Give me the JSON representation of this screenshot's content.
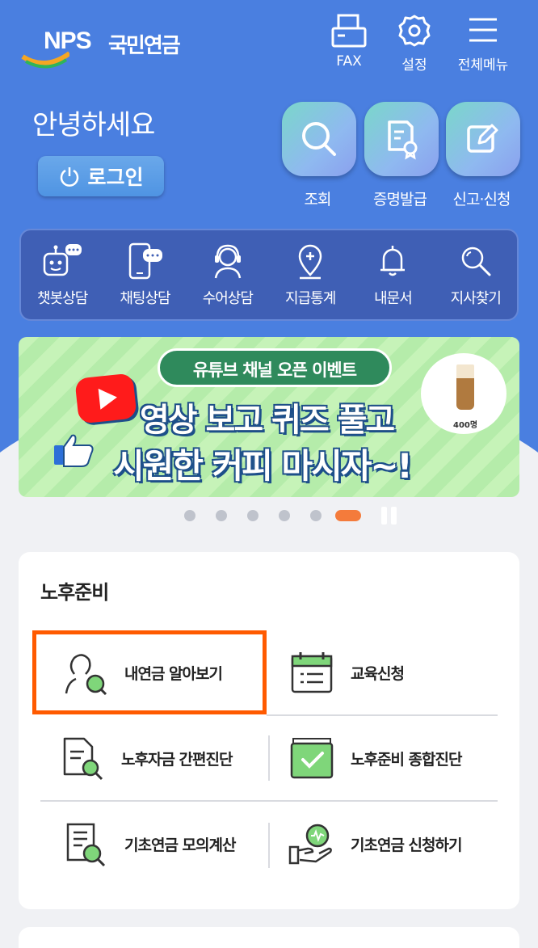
{
  "header": {
    "logo_text": "NPS",
    "logo_name": "국민연금",
    "buttons": [
      {
        "label": "FAX",
        "icon": "fax-icon"
      },
      {
        "label": "설정",
        "icon": "gear-icon"
      },
      {
        "label": "전체메뉴",
        "icon": "menu-icon"
      }
    ]
  },
  "greeting": {
    "text": "안녕하세요",
    "login_label": "로그인"
  },
  "quick_actions": [
    {
      "label": "조회",
      "icon": "search-icon"
    },
    {
      "label": "증명발급",
      "icon": "certificate-icon"
    },
    {
      "label": "신고·신청",
      "icon": "edit-icon"
    }
  ],
  "services": [
    {
      "label": "챗봇상담",
      "icon": "chatbot-icon"
    },
    {
      "label": "채팅상담",
      "icon": "chat-phone-icon"
    },
    {
      "label": "수어상담",
      "icon": "sign-language-icon"
    },
    {
      "label": "지급통계",
      "icon": "location-icon"
    },
    {
      "label": "내문서",
      "icon": "bell-icon"
    },
    {
      "label": "지사찾기",
      "icon": "search-icon"
    }
  ],
  "banner": {
    "pill": "유튜브 채널 오픈 이벤트",
    "line1": "영상 보고 퀴즈 풀고",
    "line2": "시원한 커피 마시자~!",
    "coffee_count": "400명",
    "dot_count": 6,
    "active_dot": 6
  },
  "retirement": {
    "title": "노후준비",
    "items": [
      {
        "label": "내연금 알아보기",
        "icon": "person-search-icon"
      },
      {
        "label": "교육신청",
        "icon": "calendar-icon"
      },
      {
        "label": "노후자금 간편진단",
        "icon": "document-search-icon"
      },
      {
        "label": "노후준비 종합진단",
        "icon": "check-folder-icon"
      },
      {
        "label": "기초연금 모의계산",
        "icon": "calculator-doc-icon"
      },
      {
        "label": "기초연금 신청하기",
        "icon": "hand-coin-icon"
      }
    ]
  },
  "colors": {
    "hero": "#4a7fe0",
    "service_bar": "#3f5fb5",
    "highlight": "#ff5a00",
    "active_dot": "#f47b3b"
  }
}
